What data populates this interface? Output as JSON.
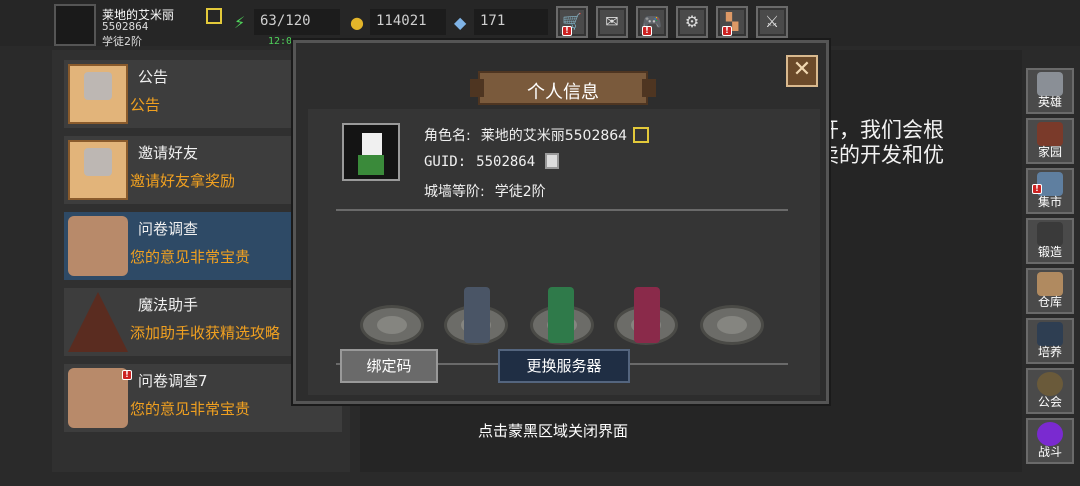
{
  "player": {
    "name": "莱地的艾米丽",
    "id": "5502864",
    "rank": "学徒2阶",
    "clock": "12:0"
  },
  "resources": {
    "energy": "63/120",
    "gold": "114021",
    "gems": "171"
  },
  "left_list": [
    {
      "title": "公告",
      "subtitle": "公告"
    },
    {
      "title": "邀请好友",
      "subtitle": "邀请好友拿奖励"
    },
    {
      "title": "问卷调查",
      "subtitle": "您的意见非常宝贵"
    },
    {
      "title": "魔法助手",
      "subtitle": "添加助手收获精选攻略"
    },
    {
      "title": "问卷调查7",
      "subtitle": "您的意见非常宝贵"
    }
  ],
  "background_text": {
    "line1": "开，我们会根",
    "line2": "卖的开发和优",
    "line3": "！"
  },
  "side_menu": [
    "英雄",
    "家园",
    "集市",
    "锻造",
    "仓库",
    "培养",
    "公会",
    "战斗"
  ],
  "modal": {
    "title": "个人信息",
    "close_glyph": "✕",
    "name_label": "角色名:",
    "name_value": "莱地的艾米丽5502864",
    "guid_label": "GUID:",
    "guid_value": "5502864",
    "rank_label": "城墙等阶:",
    "rank_value": "学徒2阶",
    "bind_button": "绑定码",
    "switch_button": "更换服务器"
  },
  "hint": "点击蒙黑区域关闭界面",
  "colors": {
    "accent_orange": "#f0a020",
    "edit_yellow": "#e3c93a",
    "selected_row": "#2e4a66",
    "clock_green": "#4fd15a"
  }
}
